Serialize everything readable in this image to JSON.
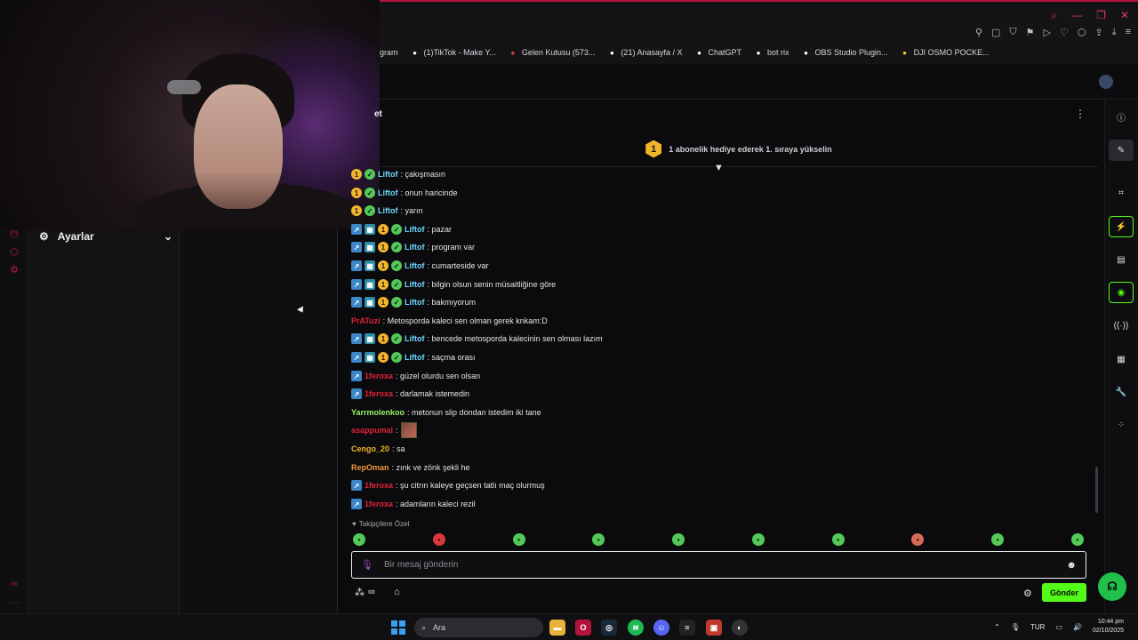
{
  "bookmarks": [
    {
      "label": "gram",
      "icon": "instagram-icon",
      "color": "#c13584"
    },
    {
      "label": "(1)TikTok - Make Y...",
      "icon": "tiktok-icon",
      "color": "#ffffff"
    },
    {
      "label": "Gelen Kutusu (573...",
      "icon": "gmail-icon",
      "color": "#ea4335"
    },
    {
      "label": "(21) Anasayfa / X",
      "icon": "x-icon",
      "color": "#ffffff"
    },
    {
      "label": "ChatGPT",
      "icon": "chatgpt-icon",
      "color": "#ffffff"
    },
    {
      "label": "bot rix",
      "icon": "botrix-icon",
      "color": "#ffffff"
    },
    {
      "label": "OBS Studio Plugin...",
      "icon": "obs-icon",
      "color": "#ffffff"
    },
    {
      "label": "DJI OSMO POCKE...",
      "icon": "dji-icon",
      "color": "#f2d02b"
    }
  ],
  "sidebar": {
    "settings_label": "Ayarlar"
  },
  "chat": {
    "title": "et",
    "gift_level": "1",
    "gift_text": "1 abonelik hediye ederek 1. sıraya yükselin",
    "messages": [
      {
        "user": "Liftof",
        "user_color": "#6fd6ff",
        "text": ": çakışmasın",
        "badges": [
          "gold",
          "check"
        ]
      },
      {
        "user": "Liftof",
        "user_color": "#6fd6ff",
        "text": ": onun haricinde",
        "badges": [
          "gold",
          "check"
        ]
      },
      {
        "user": "Liftof",
        "user_color": "#6fd6ff",
        "text": ": yarın",
        "badges": [
          "gold",
          "check"
        ]
      },
      {
        "user": "Liftof",
        "user_color": "#6fd6ff",
        "text": ": pazar",
        "badges": [
          "arrow",
          "grid",
          "gold",
          "check"
        ]
      },
      {
        "user": "Liftof",
        "user_color": "#6fd6ff",
        "text": ": program var",
        "badges": [
          "arrow",
          "grid",
          "gold",
          "check"
        ]
      },
      {
        "user": "Liftof",
        "user_color": "#6fd6ff",
        "text": ": cumarteside var",
        "badges": [
          "arrow",
          "grid",
          "gold",
          "check"
        ]
      },
      {
        "user": "Liftof",
        "user_color": "#6fd6ff",
        "text": ": bilgin olsun senin müsaitliğine göre",
        "badges": [
          "arrow",
          "grid",
          "gold",
          "check"
        ]
      },
      {
        "user": "Liftof",
        "user_color": "#6fd6ff",
        "text": ": bakmıyorum",
        "badges": [
          "arrow",
          "grid",
          "gold",
          "check"
        ]
      },
      {
        "user": "PrATuzi",
        "user_color": "#e0233a",
        "text": ": Metosporda kaleci sen olman gerek knkam:D",
        "badges": []
      },
      {
        "user": "Liftof",
        "user_color": "#6fd6ff",
        "text": ": bencede metosporda kalecinin sen olması lazım",
        "badges": [
          "arrow",
          "grid",
          "gold",
          "check"
        ]
      },
      {
        "user": "Liftof",
        "user_color": "#6fd6ff",
        "text": ": saçma orası",
        "badges": [
          "arrow",
          "grid",
          "gold",
          "check"
        ]
      },
      {
        "user": "1feroxa",
        "user_color": "#e0233a",
        "text": ": güzel olurdu sen olsan",
        "badges": [
          "arrow"
        ]
      },
      {
        "user": "1feroxa",
        "user_color": "#e0233a",
        "text": ": darlamak istemedin",
        "badges": [
          "arrow"
        ]
      },
      {
        "user": "Yarrmolenkoo",
        "user_color": "#9cf26b",
        "text": ": metonun slip dondan istedim iki tane",
        "badges": []
      },
      {
        "user": "asappumal",
        "user_color": "#e0233a",
        "text": ":",
        "badges": [],
        "emote": true
      },
      {
        "user": "Cengo_20",
        "user_color": "#f2b52b",
        "text": ": sa",
        "badges": []
      },
      {
        "user": "RepOman",
        "user_color": "#f29a3a",
        "text": ": zınk ve zönk şekli he",
        "badges": []
      },
      {
        "user": "1feroxa",
        "user_color": "#e0233a",
        "text": ": şu citrın kaleye geçsen tatlı maç olurmuş",
        "badges": [
          "arrow"
        ]
      },
      {
        "user": "1feroxa",
        "user_color": "#e0233a",
        "text": ": adamların kaleci rezil",
        "badges": [
          "arrow"
        ]
      }
    ],
    "follower_label": "Takipçilere Özel",
    "emote_colors": [
      "#53c95a",
      "#d9383a",
      "#53c95a",
      "#53c95a",
      "#53c95a",
      "#53c95a",
      "#53c95a",
      "#d96a5a",
      "#53c95a",
      "#53c95a"
    ],
    "input_placeholder": "Bir mesaj gönderin",
    "send_label": "Gönder"
  },
  "taskbar": {
    "search_placeholder": "Ara",
    "language": "TUR",
    "time": "10:44 pm",
    "date": "02/10/2025"
  },
  "colors": {
    "accent": "#53fc18",
    "brand_red": "#c0163f"
  }
}
